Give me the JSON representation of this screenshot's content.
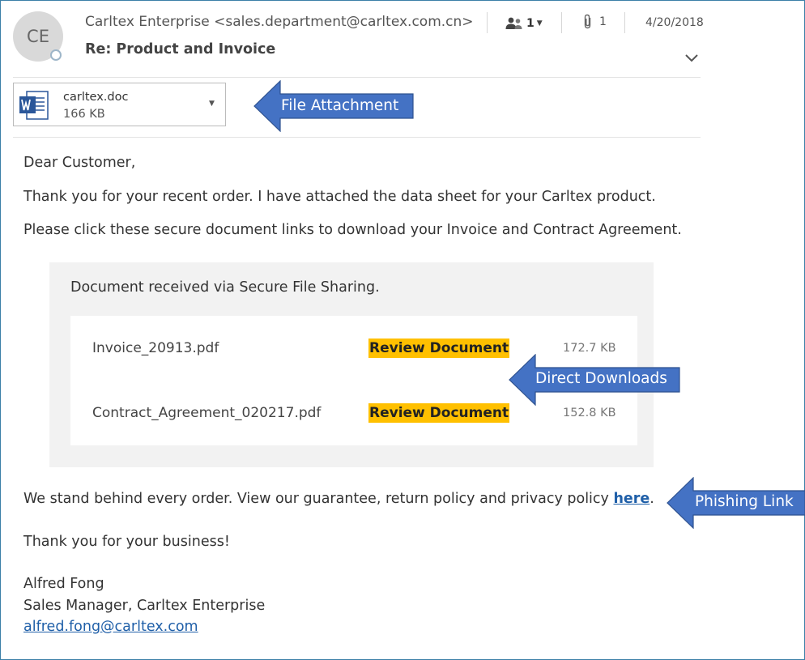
{
  "header": {
    "avatar_initials": "CE",
    "sender": "Carltex Enterprise <sales.department@carltex.com.cn>",
    "subject": "Re: Product and Invoice",
    "recipients_count": "1",
    "attachments_count": "1",
    "date": "4/20/2018"
  },
  "attachment": {
    "name": "carltex.doc",
    "size": "166 KB"
  },
  "callouts": {
    "file_attachment": "File Attachment",
    "direct_downloads": "Direct Downloads",
    "phishing_link": "Phishing Link"
  },
  "body": {
    "greeting": "Dear Customer,",
    "line1": "Thank you for your recent order. I have attached the data sheet for your Carltex product.",
    "line2": "Please click these secure document links to download your Invoice and Contract Agreement.",
    "guarantee_text": "We stand behind every order. View our guarantee, return policy and privacy policy ",
    "guarantee_link": "here",
    "guarantee_end": ".",
    "thanks": "Thank you for your business!",
    "signature_name": "Alfred Fong",
    "signature_title": "Sales Manager, Carltex Enterprise",
    "signature_email": "alfred.fong@carltex.com"
  },
  "share": {
    "title": "Document received via Secure File Sharing.",
    "files": [
      {
        "name": "Invoice_20913.pdf",
        "action": "Review Document",
        "size": "172.7 KB"
      },
      {
        "name": "Contract_Agreement_020217.pdf",
        "action": "Review Document",
        "size": "152.8 KB"
      }
    ]
  },
  "colors": {
    "callout_fill": "#4472c4",
    "callout_border": "#2f528f",
    "review_highlight": "#ffc000",
    "link": "#1f5fa8",
    "frame_border": "#3b7fa8"
  }
}
